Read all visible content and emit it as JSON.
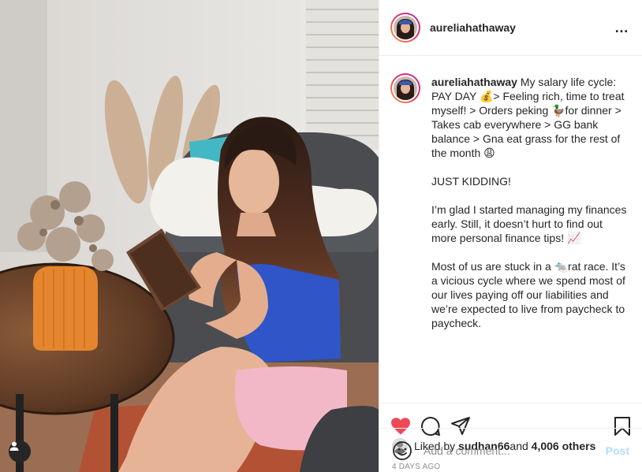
{
  "post": {
    "username": "aureliahathaway",
    "more_icon": "…",
    "caption_user": "aureliahathaway",
    "caption_text": " My salary life cycle: PAY DAY 💰> Feeling rich, time to treat myself! > Orders peking 🦆for dinner > Takes cab everywhere > GG bank balance > Gna eat grass for the rest of the month 😩\n\nJUST KIDDING!\n\nI’m glad I started managing my finances early. Still, it doesn’t hurt to find out more personal finance tips! 📈\n\nMost of us are stuck in a 🐀rat race. It’s a vicious cycle where we spend most of our lives paying off our liabilities and we’re expected to live from paycheck to paycheck.",
    "likes": {
      "prefix": "Liked by ",
      "user": "sudhan66",
      "middle": " and ",
      "others": "4,006 others"
    },
    "time_ago": "4 DAYS AGO",
    "comment_placeholder": "Add a comment...",
    "post_label": "Post"
  },
  "colors": {
    "like_red": "#ed4956",
    "post_disabled": "#b2dffc",
    "muted": "#8e8e8e"
  },
  "icons": {
    "like": "heart-icon",
    "comment": "comment-icon",
    "share": "share-icon",
    "save": "bookmark-icon",
    "tag": "user-tag-icon",
    "emoji": "emoji-icon"
  }
}
